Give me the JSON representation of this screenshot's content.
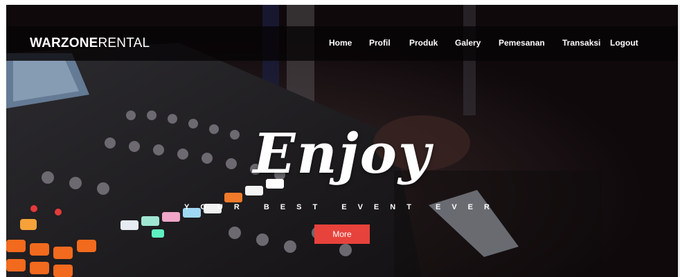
{
  "brand": {
    "strong": "WARZONE",
    "light": "RENTAL"
  },
  "nav": {
    "items": [
      "Home",
      "Profil",
      "Produk",
      "Galery",
      "Pemesanan",
      "Transaksi",
      "Logout"
    ]
  },
  "hero": {
    "headline": "Enjoy",
    "tagline": "YOUR BEST EVENT EVER",
    "cta_label": "More"
  },
  "colors": {
    "navbar_bg": "#060405",
    "cta_bg": "#e8423c",
    "text": "#ffffff"
  }
}
